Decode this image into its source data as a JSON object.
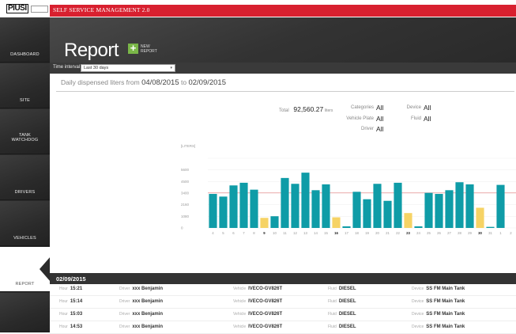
{
  "app": {
    "logo": "PIUSI",
    "title": "SELF SERVICE MANAGEMENT 2.0"
  },
  "sidebar": {
    "items": [
      {
        "label": "DASHBOARD"
      },
      {
        "label": "SITE"
      },
      {
        "label": "TANK WATCHDOG"
      },
      {
        "label": "DRIVERS"
      },
      {
        "label": "VEHICLES"
      },
      {
        "label": "REPORT"
      },
      {
        "label": ""
      }
    ]
  },
  "header": {
    "title": "Report",
    "new_report_line1": "NEW",
    "new_report_line2": "REPORT"
  },
  "filter": {
    "label": "Time interval",
    "value": "Last 30 days"
  },
  "summary": {
    "prefix": "Daily dispensed liters from",
    "from": "04/08/2015",
    "to_word": "to",
    "to": "02/09/2015",
    "total_label": "Total",
    "total_value": "92,560.27",
    "total_unit": "liters",
    "categories_label": "Categories",
    "categories_value": "All",
    "vehicle_label": "Vehicle Plate",
    "vehicle_value": "All",
    "driver_label": "Driver",
    "driver_value": "All",
    "device_label": "Device",
    "device_value": "All",
    "fluid_label": "Fluid",
    "fluid_value": "All"
  },
  "colors": {
    "teal": "#0f9ca7",
    "yellow": "#f6d365",
    "red": "#d8202f"
  },
  "chart_data": {
    "type": "bar",
    "ylabel": "[LITERS]",
    "yticks": [
      "",
      "5600",
      "4500",
      "3400",
      "2160",
      "1080",
      "0"
    ],
    "average": 3300,
    "categories": [
      "4",
      "5",
      "6",
      "7",
      "8",
      "9",
      "10",
      "11",
      "12",
      "13",
      "14",
      "15",
      "16",
      "17",
      "18",
      "19",
      "20",
      "21",
      "22",
      "23",
      "24",
      "25",
      "26",
      "27",
      "28",
      "29",
      "30",
      "31",
      "1",
      "2"
    ],
    "values": [
      3200,
      2950,
      4000,
      4250,
      3600,
      950,
      1100,
      4700,
      4150,
      5200,
      3550,
      4100,
      1000,
      150,
      3400,
      2700,
      4150,
      2550,
      4250,
      1400,
      150,
      3300,
      3200,
      3550,
      4300,
      4100,
      1900,
      100,
      4050,
      0
    ],
    "highlight": [
      false,
      false,
      false,
      false,
      false,
      true,
      false,
      false,
      false,
      false,
      false,
      false,
      true,
      false,
      false,
      false,
      false,
      false,
      false,
      true,
      false,
      false,
      false,
      false,
      false,
      false,
      true,
      false,
      false,
      false
    ],
    "bold_labels": [
      "9",
      "16",
      "23",
      "30"
    ]
  },
  "day_section": {
    "date": "02/09/2015",
    "rows": [
      {
        "hour_label": "Hour",
        "hour": "15:21",
        "driver_label": "Driver",
        "driver": "xxx Benjamin",
        "vehicle_label": "Vehicle",
        "vehicle": "IVECO-GV826T",
        "fluid_label": "Fluid",
        "fluid": "DIESEL",
        "device_label": "Device",
        "device": "SS FM Main Tank"
      },
      {
        "hour_label": "Hour",
        "hour": "15:14",
        "driver_label": "Driver",
        "driver": "xxx Benjamin",
        "vehicle_label": "Vehicle",
        "vehicle": "IVECO-GV826T",
        "fluid_label": "Fluid",
        "fluid": "DIESEL",
        "device_label": "Device",
        "device": "SS FM Main Tank"
      },
      {
        "hour_label": "Hour",
        "hour": "15:03",
        "driver_label": "Driver",
        "driver": "xxx Benjamin",
        "vehicle_label": "Vehicle",
        "vehicle": "IVECO-GV826T",
        "fluid_label": "Fluid",
        "fluid": "DIESEL",
        "device_label": "Device",
        "device": "SS FM Main Tank"
      },
      {
        "hour_label": "Hour",
        "hour": "14:53",
        "driver_label": "Driver",
        "driver": "xxx Benjamin",
        "vehicle_label": "Vehicle",
        "vehicle": "IVECO-GV826T",
        "fluid_label": "Fluid",
        "fluid": "DIESEL",
        "device_label": "Device",
        "device": "SS FM Main Tank"
      }
    ]
  }
}
